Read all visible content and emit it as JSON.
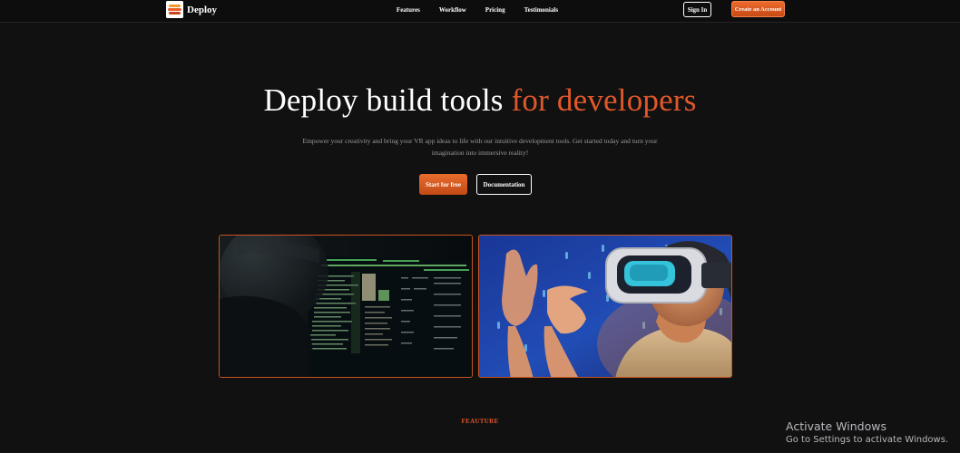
{
  "nav": {
    "brand": "Deploy",
    "links": [
      "Features",
      "Workflow",
      "Pricing",
      "Testimonials"
    ],
    "sign_in": "Sign In",
    "create_account": "Create an Account"
  },
  "hero": {
    "title_main": "Deploy build tools",
    "title_accent": "for developers",
    "subtitle": "Empower your creativity and bring your VR app ideas to life with our intuitive development tools. Get started today and turn your imagination into immersive reality!",
    "cta_primary": "Start for free",
    "cta_secondary": "Documentation"
  },
  "images": {
    "left": "code-screen-photo",
    "right": "vr-headset-photo"
  },
  "section": {
    "label": "FEAUTURE"
  },
  "watermark": {
    "title": "Activate Windows",
    "subtitle": "Go to Settings to activate Windows."
  },
  "colors": {
    "accent": "#e0582a",
    "background": "#111112"
  }
}
